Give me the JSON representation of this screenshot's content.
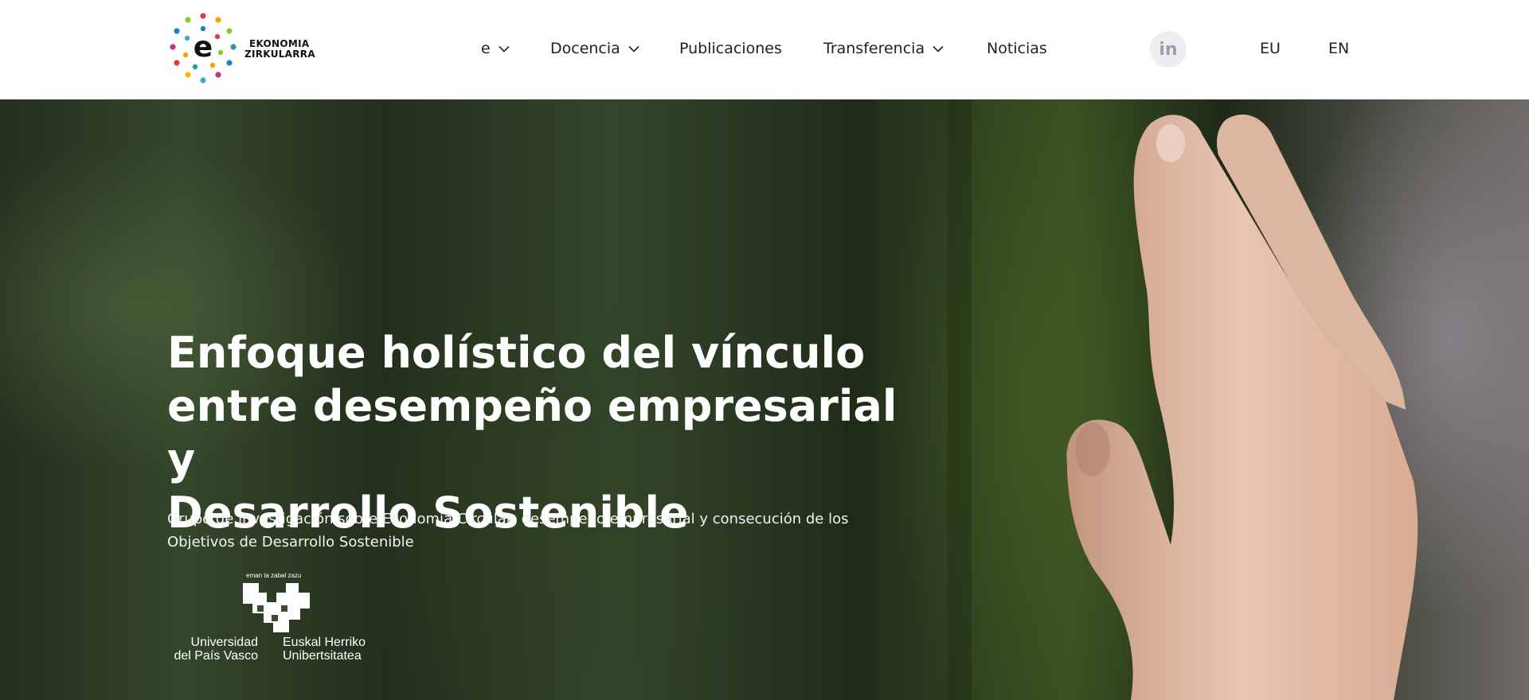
{
  "brand": {
    "logo_letter": "e",
    "name_line1": "EKONOMIA",
    "name_line2": "ZIRKULARRA"
  },
  "nav": {
    "items": [
      {
        "label": "e",
        "has_dropdown": true
      },
      {
        "label": "Docencia",
        "has_dropdown": true
      },
      {
        "label": "Publicaciones",
        "has_dropdown": false
      },
      {
        "label": "Transferencia",
        "has_dropdown": true
      },
      {
        "label": "Noticias",
        "has_dropdown": false
      }
    ],
    "social_icon": "linkedin-icon",
    "social_label": "in",
    "languages": [
      "EU",
      "EN"
    ]
  },
  "hero": {
    "title_lines": [
      "Enfoque holístico del vínculo",
      "entre desempeño empresarial y",
      "Desarrollo Sostenible"
    ],
    "subtitle_lines": [
      "Grupo de investigación sobre Economía Circular, desempeño empresarial y consecución de los",
      "Objetivos de Desarrollo Sostenible"
    ]
  },
  "university": {
    "motto": "eman ta zabal zazu",
    "left_line1": "Universidad",
    "left_line2": "del País Vasco",
    "right_line1": "Euskal Herriko",
    "right_line2": "Unibertsitatea"
  },
  "colors": {
    "header_bg": "#ffffff",
    "nav_text": "#222222",
    "hero_text": "#ffffff",
    "logo_dots": [
      "#e63946",
      "#f4a300",
      "#2a9d8f",
      "#1d7fd1",
      "#8ac926",
      "#c0327a",
      "#ffb703",
      "#3fa7d6"
    ]
  }
}
